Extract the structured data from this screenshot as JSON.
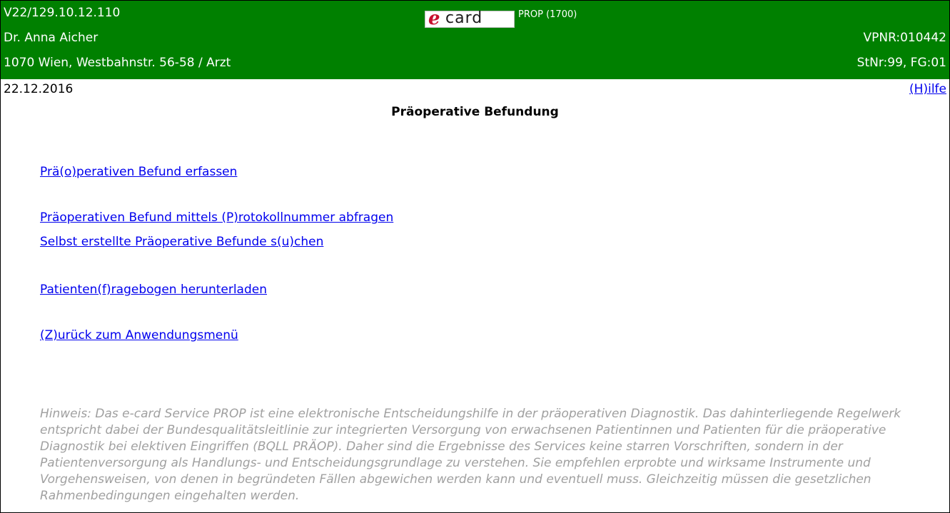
{
  "header": {
    "version": "V22/129.10.12.110",
    "doctor_name": "Dr. Anna Aicher",
    "address": "1070 Wien, Westbahnstr. 56-58 / Arzt",
    "vpnr": "VPNR:010442",
    "stnr": "StNr:99, FG:01",
    "logo": {
      "e_letter": "e",
      "card_text": "card"
    },
    "app_label": "PROP (1700)"
  },
  "date": "22.12.2016",
  "help_label": "(H)ilfe",
  "page_title": "Präoperative Befundung",
  "menu": {
    "record_finding": "Prä(o)perativen Befund erfassen",
    "query_by_protocol": "Präoperativen Befund mittels (P)rotokollnummer abfragen",
    "search_own": "Selbst erstellte Präoperative Befunde s(u)chen",
    "download_questionnaire": "Patienten(f)ragebogen herunterladen",
    "back_to_menu": "(Z)urück zum Anwendungsmenü"
  },
  "note": "Hinweis: Das e-card Service PROP ist eine elektronische Entscheidungshilfe in der präoperativen Diagnostik. Das dahinterliegende Regelwerk entspricht dabei der Bundesqualitätsleitlinie zur integrierten Versorgung von erwachsenen Patientinnen und Patienten für die präoperative Diagnostik bei elektiven Eingriffen (BQLL PRÄOP). Daher sind die Ergebnisse des Services keine starren Vorschriften, sondern in der Patientenversorgung als Handlungs- und Entscheidungsgrundlage zu verstehen. Sie empfehlen erprobte und wirksame Instrumente und Vorgehensweisen, von denen in begründeten Fällen abgewichen werden kann und eventuell muss. Gleichzeitig müssen die gesetzlichen Rahmenbedingungen eingehalten werden.",
  "colors": {
    "header_green": "#008000",
    "link_blue": "#0000ee",
    "note_gray": "#a0a0a0",
    "logo_red": "#c8102e"
  }
}
